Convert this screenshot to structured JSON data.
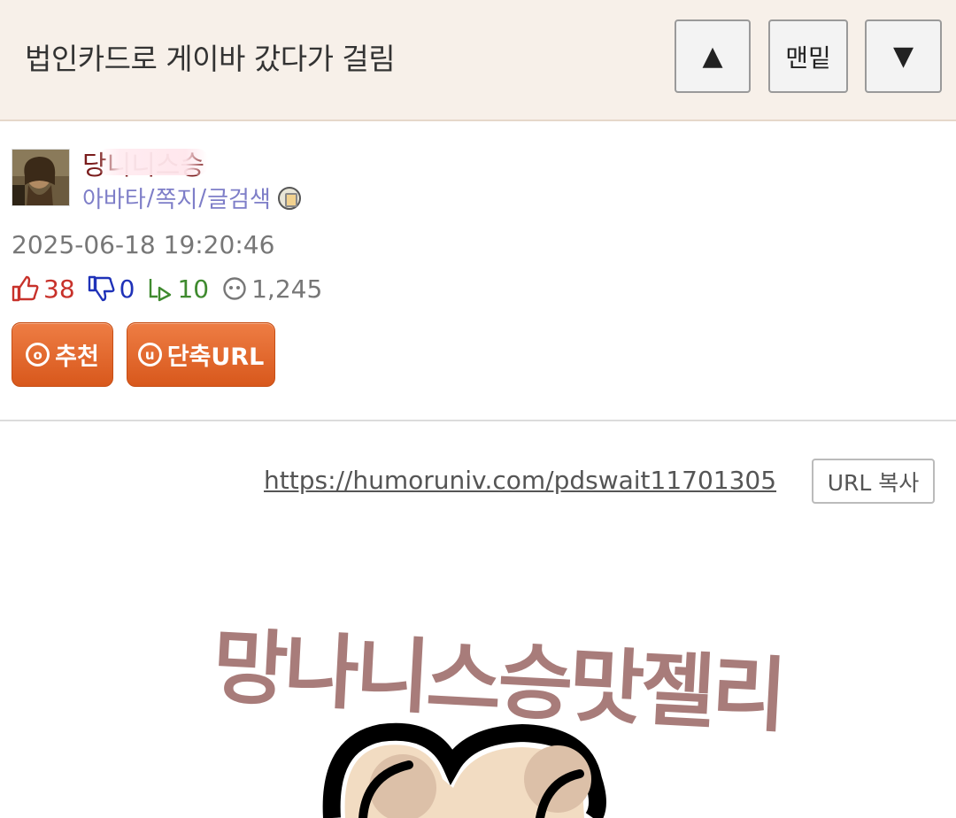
{
  "header": {
    "title": "법인카드로 게이바 갔다가 걸림",
    "up_label": "▲",
    "bottom_label": "맨밑",
    "down_label": "▼"
  },
  "author": {
    "nickname": "당니니스승",
    "links": [
      "아바타",
      "쪽지",
      "글검색"
    ],
    "link_separator": "/",
    "badge_icon": "level-badge-icon"
  },
  "post": {
    "datetime": "2025-06-18 19:20:46",
    "upvotes": "38",
    "downvotes": "0",
    "replies": "10",
    "views": "1,245",
    "recommend_label": "추천",
    "shorturl_label": "단축URL",
    "recommend_ring": "o",
    "shorturl_ring": "u",
    "url": "https://humoruniv.com/pdswait11701305",
    "copy_label": "URL 복사"
  },
  "image": {
    "caption_text": "망나니스승맛젤리"
  },
  "colors": {
    "header_bg": "#f7f0e9",
    "accent_orange": "#e06a2c",
    "upvote_red": "#c8322b",
    "downvote_blue": "#1f32b8",
    "reply_green": "#3f8a2f",
    "link_purple": "#7e7ec8"
  }
}
